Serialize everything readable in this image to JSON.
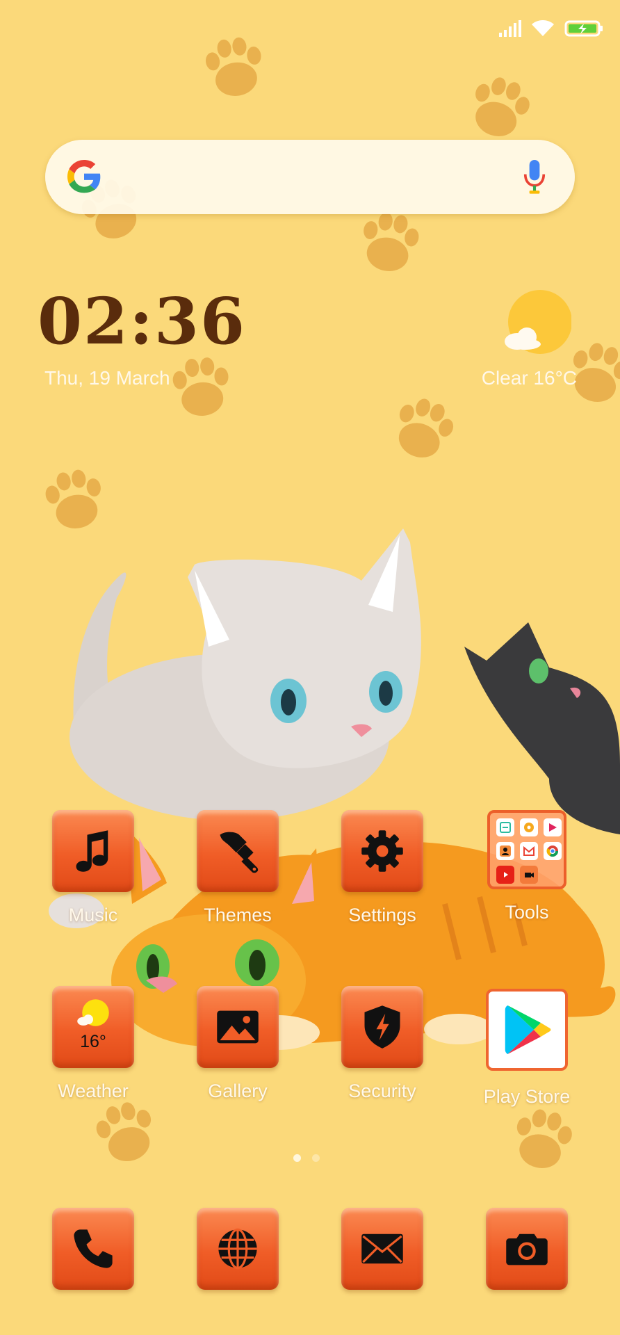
{
  "status_bar": {
    "signal_icon": "signal-bars-icon",
    "wifi_icon": "wifi-icon",
    "battery_icon": "battery-charging-icon"
  },
  "search_bar": {
    "logo_icon": "google-g-icon",
    "voice_icon": "microphone-icon"
  },
  "clock_widget": {
    "time": "02:36",
    "date": "Thu, 19 March"
  },
  "weather_widget": {
    "icon": "sun-cloud-icon",
    "text": "Clear  16°C"
  },
  "home_row_1": [
    {
      "label": "Music",
      "icon": "music-note-icon"
    },
    {
      "label": "Themes",
      "icon": "paint-brush-icon"
    },
    {
      "label": "Settings",
      "icon": "gear-icon"
    },
    {
      "label": "Tools",
      "icon": "folder-icon"
    }
  ],
  "home_row_2": [
    {
      "label": "Weather",
      "icon": "weather-icon",
      "badge": "16°"
    },
    {
      "label": "Gallery",
      "icon": "image-icon"
    },
    {
      "label": "Security",
      "icon": "shield-bolt-icon"
    },
    {
      "label": "Play Store",
      "icon": "play-store-icon"
    }
  ],
  "page_indicator": {
    "pages": 2,
    "current": 1
  },
  "dock": [
    {
      "icon": "phone-icon"
    },
    {
      "icon": "globe-icon"
    },
    {
      "icon": "mail-icon"
    },
    {
      "icon": "camera-icon"
    }
  ],
  "colors": {
    "wallpaper": "#fbd97a",
    "icon_tile": "#f05d27",
    "clock_text": "#5a2c0c",
    "label_text": "#fff8ea"
  }
}
